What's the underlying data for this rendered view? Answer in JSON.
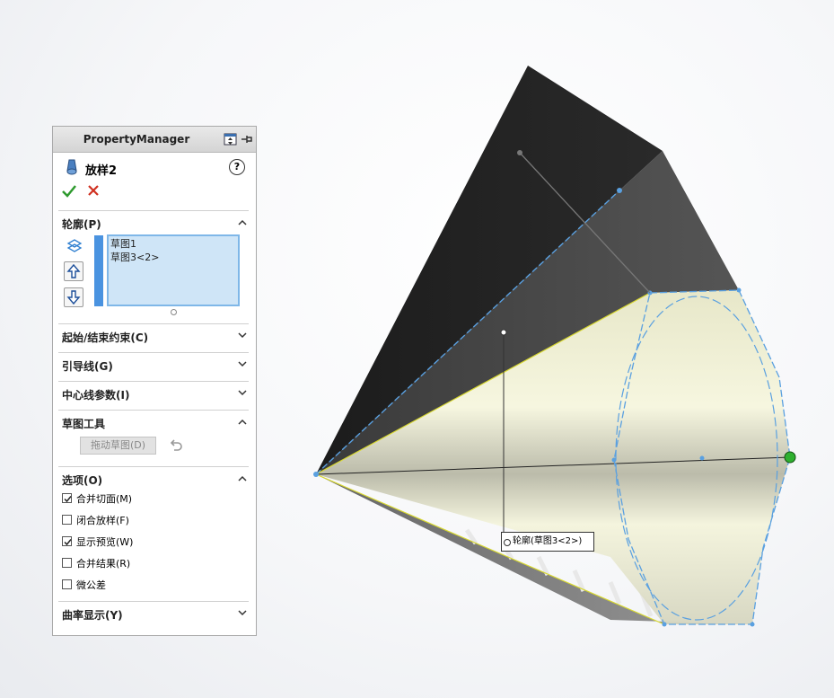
{
  "property_manager": {
    "title": "PropertyManager",
    "feature_name": "放样2",
    "help": "?",
    "sections": {
      "profiles": {
        "title": "轮廓(P)",
        "items": [
          "草图1",
          "草图3<2>"
        ]
      },
      "constraints": {
        "title": "起始/结束约束(C)"
      },
      "guides": {
        "title": "引导线(G)"
      },
      "centerline": {
        "title": "中心线参数(I)"
      },
      "sketch_tools": {
        "title": "草图工具",
        "drag_sketch_label": "拖动草图(D)"
      },
      "options": {
        "title": "选项(O)",
        "items": [
          {
            "label": "合并切面(M)",
            "checked": true
          },
          {
            "label": "闭合放样(F)",
            "checked": false
          },
          {
            "label": "显示预览(W)",
            "checked": true
          },
          {
            "label": "合并结果(R)",
            "checked": false
          },
          {
            "label": "微公差",
            "checked": false
          }
        ]
      },
      "curvature": {
        "title": "曲率显示(Y)"
      }
    }
  },
  "viewport": {
    "callout_text": "轮廓(草图3<2>)",
    "accent_color": "#5aa0e0",
    "preview_color": "#f4f4d8"
  }
}
